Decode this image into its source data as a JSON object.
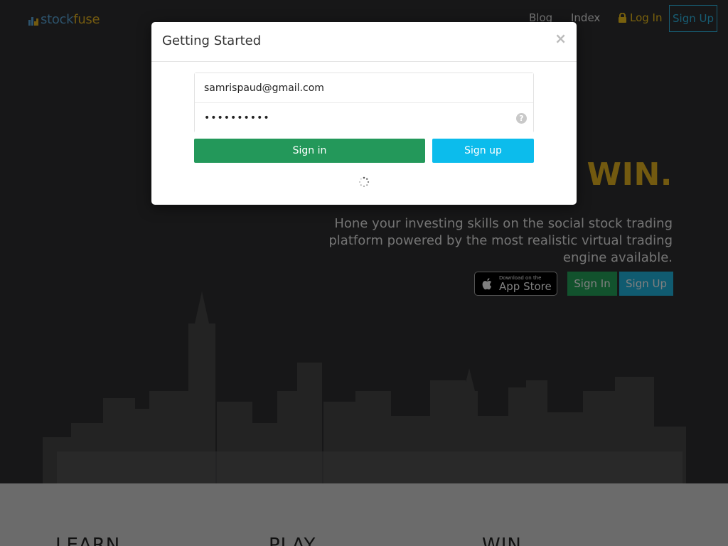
{
  "navbar": {
    "logo_stock": "stock",
    "logo_fuse": "fuse",
    "links": {
      "blog": "Blog",
      "index": "Index",
      "login": "Log In",
      "signup": "Sign Up"
    }
  },
  "hero": {
    "headline_prefix": ".",
    "headline_accent": "WIN.",
    "subtext": "Hone your investing skills on the social stock trading platform powered by the most realistic virtual trading engine available.",
    "appstore_small": "Download on the",
    "appstore_big": "App Store",
    "signin_label": "Sign In",
    "signup_label": "Sign Up"
  },
  "sections": {
    "learn": "LEARN",
    "play": "PLAY",
    "win": "WIN"
  },
  "modal": {
    "title": "Getting Started",
    "close_glyph": "×",
    "email_value": "samrispaud@gmail.com",
    "password_value": "••••••••••",
    "help_glyph": "?",
    "signin_label": "Sign in",
    "signup_label": "Sign up"
  },
  "colors": {
    "accent_gold": "#e7b521",
    "accent_blue": "#2fb9e6",
    "signin_green": "#23985a",
    "signup_cyan": "#0cbcec"
  },
  "icons": [
    "logo-bars-icon",
    "lock-icon",
    "apple-icon",
    "close-icon",
    "help-icon",
    "spinner-icon"
  ]
}
